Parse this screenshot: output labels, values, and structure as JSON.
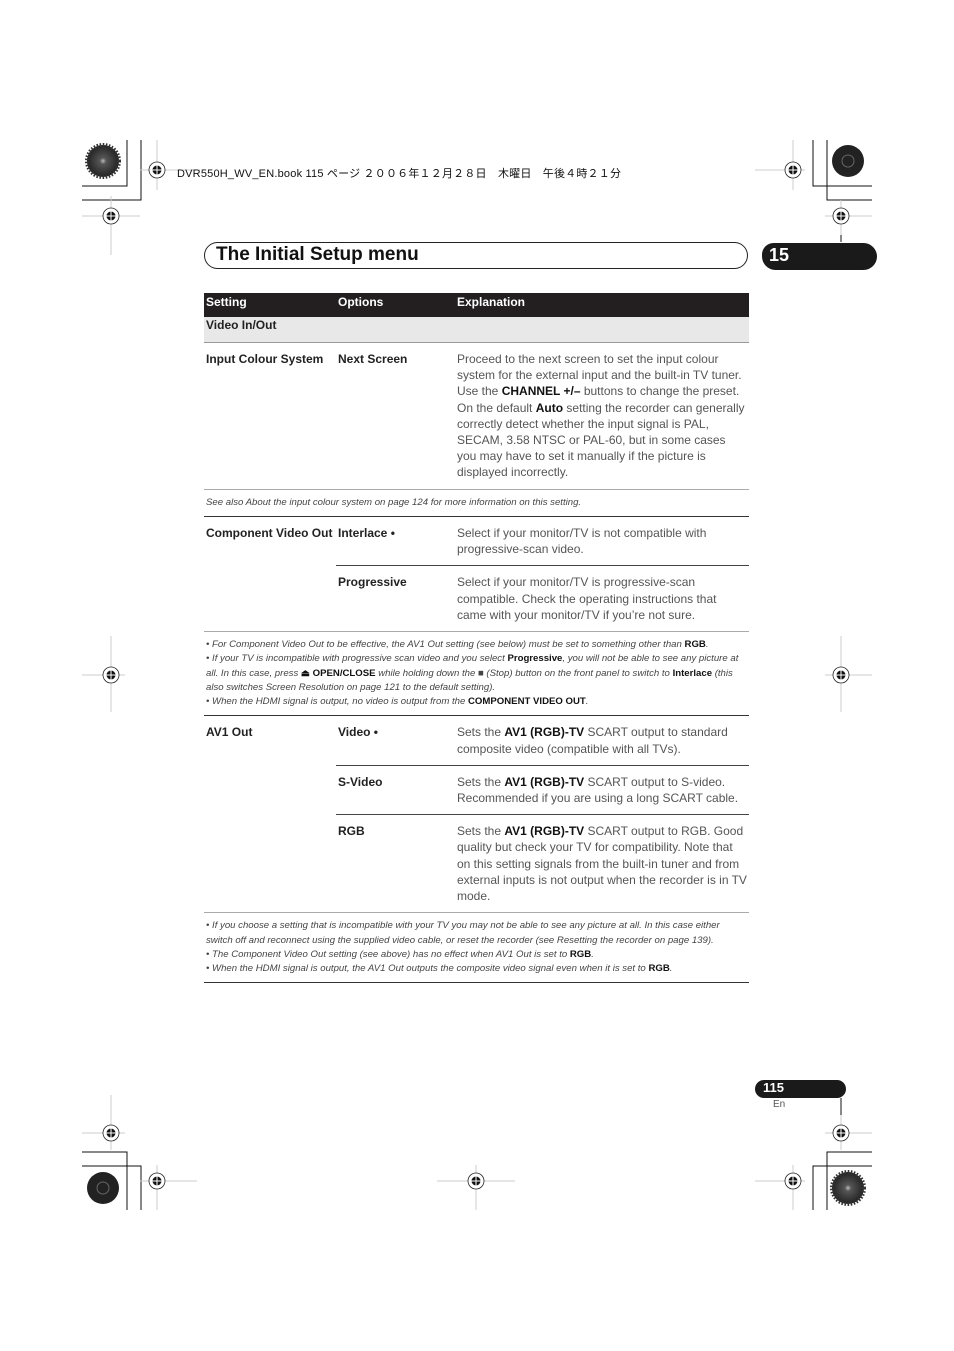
{
  "job_line": "DVR550H_WV_EN.book  115 ページ  ２００６年１２月２８日　木曜日　午後４時２１分",
  "page_title": "The Initial Setup menu",
  "chapter_number": "15",
  "table": {
    "headers": [
      "Setting",
      "Options",
      "Explanation"
    ],
    "section": "Video In/Out",
    "groups": [
      {
        "setting": "Input Colour System",
        "rows": [
          {
            "option": "Next Screen",
            "explanation": [
              {
                "t": "Proceed to the next screen to set the input colour system for the external input and the built-in TV tuner. Use the "
              },
              {
                "t": "CHANNEL +/–",
                "b": true
              },
              {
                "t": " buttons to change the preset. On the default "
              },
              {
                "t": "Auto",
                "b": true
              },
              {
                "t": " setting the recorder can generally correctly detect whether the input signal is PAL, SECAM, 3.58 NTSC or PAL-60, but in some cases you may have to set it manually if the picture is displayed incorrectly."
              }
            ]
          }
        ],
        "notes": [
          [
            {
              "t": "See also About the input colour system on page 124 for more information on this setting."
            }
          ]
        ]
      },
      {
        "setting": "Component Video Out",
        "rows": [
          {
            "option": "Interlace •",
            "explanation": [
              {
                "t": "Select if your monitor/TV is not compatible with progressive-scan video."
              }
            ]
          },
          {
            "option": "Progressive",
            "explanation": [
              {
                "t": "Select if your monitor/TV is progressive-scan compatible. Check the operating instructions that came with your monitor/TV if you’re not sure."
              }
            ]
          }
        ],
        "notes": [
          [
            {
              "t": "• For Component Video Out to be effective, the AV1 Out setting (see below) must be set to something other than "
            },
            {
              "t": "RGB",
              "b": true
            },
            {
              "t": "."
            }
          ],
          [
            {
              "t": "• If your TV is incompatible with progressive scan video and you select "
            },
            {
              "t": "Progressive",
              "b": true
            },
            {
              "t": ", you will not be able to see any picture at all. In this case, press "
            },
            {
              "t": "⏏ OPEN/CLOSE",
              "b": true
            },
            {
              "t": " while holding down the ■ (Stop) button on the front panel to switch to "
            },
            {
              "t": "Interlace",
              "b": true
            },
            {
              "t": " (this also switches Screen Resolution on page 121 to the default setting)."
            }
          ],
          [
            {
              "t": "• When the HDMI signal is output, no video is output from the "
            },
            {
              "t": "COMPONENT VIDEO OUT",
              "b": true
            },
            {
              "t": "."
            }
          ]
        ]
      },
      {
        "setting": "AV1 Out",
        "rows": [
          {
            "option": "Video •",
            "explanation": [
              {
                "t": "Sets the "
              },
              {
                "t": "AV1 (RGB)-TV",
                "b": true
              },
              {
                "t": " SCART output to standard composite video (compatible with all TVs)."
              }
            ]
          },
          {
            "option": "S-Video",
            "explanation": [
              {
                "t": "Sets the "
              },
              {
                "t": "AV1 (RGB)-TV",
                "b": true
              },
              {
                "t": " SCART output to S-video. Recommended if you are using a long SCART cable."
              }
            ]
          },
          {
            "option": "RGB",
            "explanation": [
              {
                "t": "Sets the "
              },
              {
                "t": "AV1 (RGB)-TV",
                "b": true
              },
              {
                "t": " SCART output to RGB. Good quality but check your TV for compatibility. Note that on this setting signals from the built-in tuner and from external inputs is not output when the recorder is in TV mode."
              }
            ]
          }
        ],
        "notes": [
          [
            {
              "t": "• If you choose a setting that is incompatible with your TV you may not be able to see any picture at all. In this case either switch off and reconnect using the supplied video cable, or reset the recorder (see Resetting the recorder on page 139)."
            }
          ],
          [
            {
              "t": "• The Component Video Out setting (see above) has no effect when AV1 Out is set to "
            },
            {
              "t": "RGB",
              "b": true
            },
            {
              "t": "."
            }
          ],
          [
            {
              "t": "• When the HDMI signal is output, the AV1 Out outputs the composite video signal even when it is set to "
            },
            {
              "t": "RGB",
              "b": true
            },
            {
              "t": "."
            }
          ]
        ]
      }
    ]
  },
  "footer": {
    "page_number": "115",
    "language": "En"
  }
}
